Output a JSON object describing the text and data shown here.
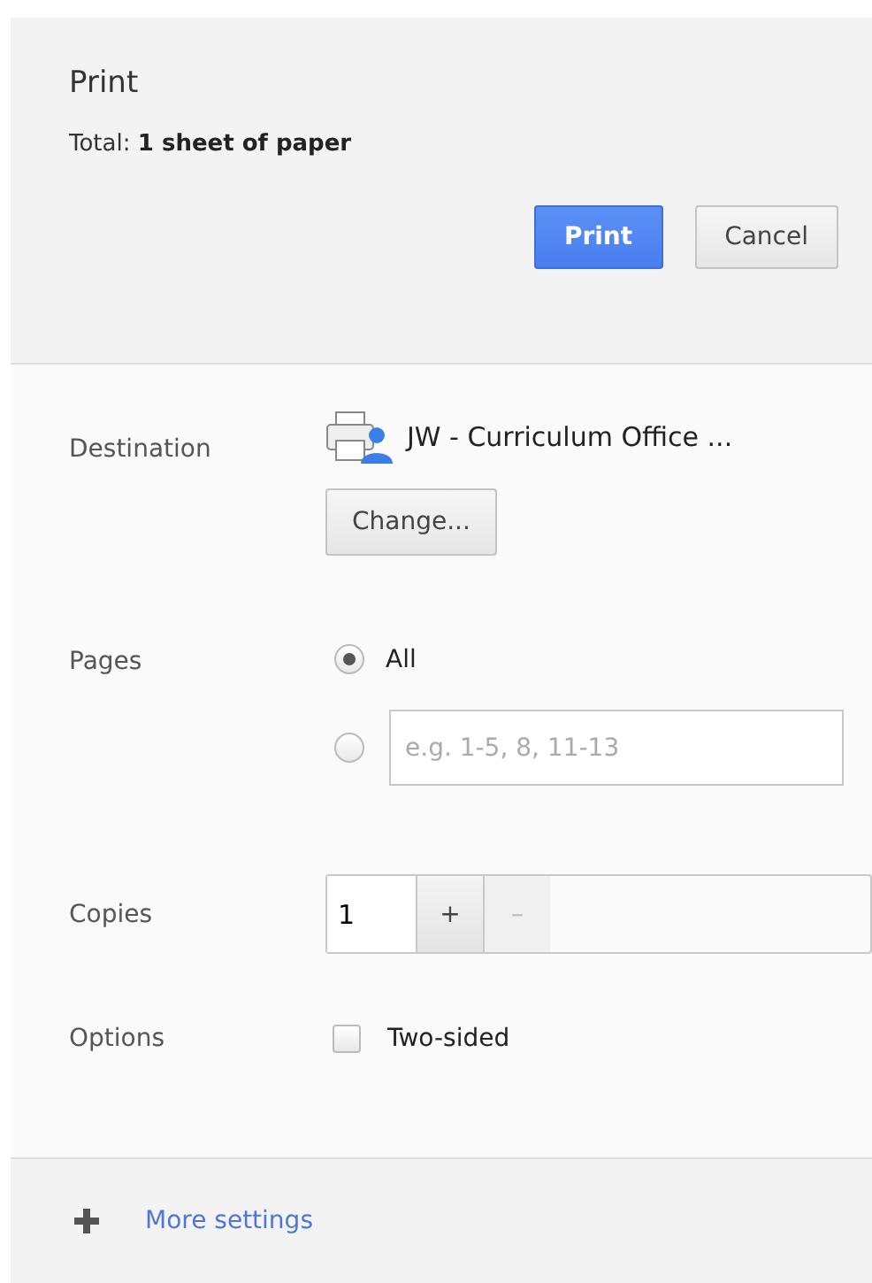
{
  "header": {
    "title": "Print",
    "total_label": "Total:",
    "total_value": "1 sheet of paper",
    "buttons": [
      {
        "label": "Print",
        "kind": "primary"
      },
      {
        "label": "Cancel",
        "kind": "secondary"
      }
    ]
  },
  "destination": {
    "label": "Destination",
    "printer": "JW - Curriculum Office ...",
    "change_button": "Change..."
  },
  "pages": {
    "label": "Pages",
    "options": [
      {
        "kind": "all",
        "label": "All",
        "selected": true
      },
      {
        "kind": "custom",
        "placeholder": "e.g. 1-5, 8, 11-13",
        "selected": false
      }
    ]
  },
  "copies": {
    "label": "Copies",
    "value": "1",
    "increment": {
      "label": "+",
      "disabled": false
    },
    "decrement": {
      "label": "–",
      "disabled": true
    }
  },
  "options": {
    "label": "Options",
    "items": [
      {
        "label": "Two-sided",
        "checked": false
      }
    ]
  },
  "footer": {
    "link": "More settings"
  }
}
